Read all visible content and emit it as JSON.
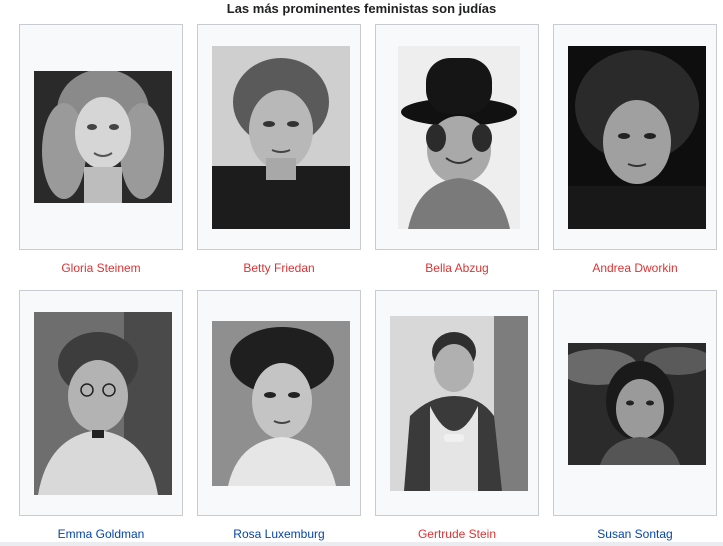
{
  "gallery": {
    "caption": "Las más prominentes feministas son judías",
    "colors": {
      "missing_link": "#d33",
      "existing_link": "#0645ad",
      "frame_border": "#c8ccd1",
      "frame_background": "#f8f9fa"
    },
    "items": [
      {
        "name": "Gloria Steinem",
        "link": "red",
        "image": "portrait-photo"
      },
      {
        "name": "Betty Friedan",
        "link": "red",
        "image": "portrait-photo"
      },
      {
        "name": "Bella Abzug",
        "link": "red",
        "image": "portrait-photo"
      },
      {
        "name": "Andrea Dworkin",
        "link": "red",
        "image": "portrait-photo"
      },
      {
        "name": "Emma Goldman",
        "link": "blue",
        "image": "portrait-photo"
      },
      {
        "name": "Rosa Luxemburg",
        "link": "blue",
        "image": "portrait-photo"
      },
      {
        "name": "Gertrude Stein",
        "link": "red",
        "image": "portrait-photo"
      },
      {
        "name": "Susan Sontag",
        "link": "blue",
        "image": "portrait-photo"
      }
    ]
  }
}
